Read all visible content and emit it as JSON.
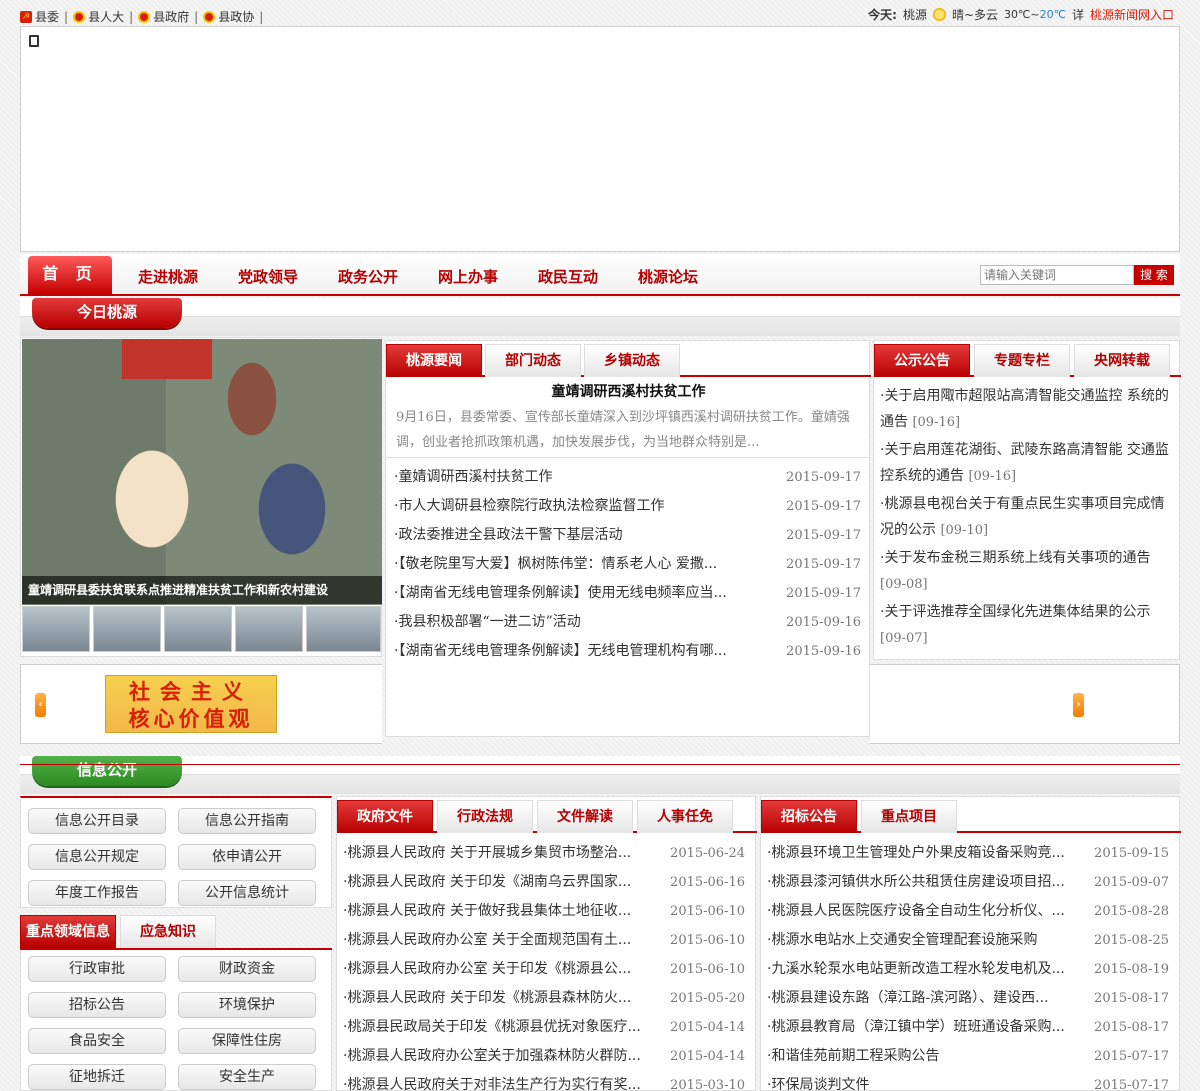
{
  "topbar": {
    "links": [
      "县委",
      "县人大",
      "县政府",
      "县政协"
    ],
    "weather_label": "今天:",
    "city": "桃源",
    "condition": "晴~多云",
    "temp_high": "30℃",
    "temp_sep": "~",
    "temp_low": "20℃",
    "detail": "详",
    "news_entry": "桃源新闻网入口"
  },
  "nav": {
    "home": "首 页",
    "items": [
      "走进桃源",
      "党政领导",
      "政务公开",
      "网上办事",
      "政民互动",
      "桃源论坛"
    ],
    "search_placeholder": "请输入关键词",
    "search_button": "搜 索"
  },
  "sections": {
    "today": "今日桃源",
    "info": "信息公开"
  },
  "photo": {
    "caption": "童靖调研县委扶贫联系点推进精准扶贫工作和新农村建设"
  },
  "news": {
    "tabs": [
      "桃源要闻",
      "部门动态",
      "乡镇动态"
    ],
    "headline": "童靖调研西溪村扶贫工作",
    "summary": "9月16日，县委常委、宣传部长童婧深入到沙坪镇西溪村调研扶贫工作。童婧强调，创业者抢抓政策机遇，加快发展步伐，为当地群众特别是...",
    "items": [
      {
        "title": "·童婧调研西溪村扶贫工作",
        "date": "2015-09-17"
      },
      {
        "title": "·市人大调研县检察院行政执法检察监督工作",
        "date": "2015-09-17"
      },
      {
        "title": "·政法委推进全县政法干警下基层活动",
        "date": "2015-09-17"
      },
      {
        "title": "·【敬老院里写大爱】枫树陈伟堂：情系老人心  爱撒...",
        "date": "2015-09-17"
      },
      {
        "title": "·【湖南省无线电管理条例解读】使用无线电频率应当...",
        "date": "2015-09-17"
      },
      {
        "title": "·我县积极部署“一进二访”活动",
        "date": "2015-09-16"
      },
      {
        "title": "·【湖南省无线电管理条例解读】无线电管理机构有哪...",
        "date": "2015-09-16"
      }
    ]
  },
  "notices": {
    "tabs": [
      "公示公告",
      "专题专栏",
      "央网转载"
    ],
    "items": [
      {
        "title": "·关于启用陬市超限站高清智能交通监控  系统的通告",
        "date": "[09-16]"
      },
      {
        "title": "·关于启用莲花湖街、武陵东路高清智能  交通监控系统的通告",
        "date": "[09-16]"
      },
      {
        "title": "·桃源县电视台关于有重点民生实事项目完成情况的公示",
        "date": "[09-10]"
      },
      {
        "title": "·关于发布金税三期系统上线有关事项的通告",
        "date": "[09-08]"
      },
      {
        "title": "·关于评选推荐全国绿化先进集体结果的公示",
        "date": "[09-07]"
      }
    ]
  },
  "values_banner": {
    "line1": "社会主义",
    "line2": "核心价值观"
  },
  "info_panel": {
    "grid1": [
      "信息公开目录",
      "信息公开指南",
      "信息公开规定",
      "依申请公开",
      "年度工作报告",
      "公开信息统计"
    ],
    "tabs": [
      "重点领域信息",
      "应急知识"
    ],
    "grid2": [
      "行政审批",
      "财政资金",
      "招标公告",
      "环境保护",
      "食品安全",
      "保障性住房",
      "征地拆迁",
      "安全生产"
    ]
  },
  "docs": {
    "tabs": [
      "政府文件",
      "行政法规",
      "文件解读",
      "人事任免"
    ],
    "items": [
      {
        "title": "·桃源县人民政府 关于开展城乡集贸市场整治...",
        "date": "2015-06-24"
      },
      {
        "title": "·桃源县人民政府 关于印发《湖南乌云界国家...",
        "date": "2015-06-16"
      },
      {
        "title": "·桃源县人民政府 关于做好我县集体土地征收...",
        "date": "2015-06-10"
      },
      {
        "title": "·桃源县人民政府办公室 关于全面规范国有土...",
        "date": "2015-06-10"
      },
      {
        "title": "·桃源县人民政府办公室 关于印发《桃源县公...",
        "date": "2015-06-10"
      },
      {
        "title": "·桃源县人民政府 关于印发《桃源县森林防火...",
        "date": "2015-05-20"
      },
      {
        "title": "·桃源县民政局关于印发《桃源县优抚对象医疗...",
        "date": "2015-04-14"
      },
      {
        "title": "·桃源县人民政府办公室关于加强森林防火群防...",
        "date": "2015-04-14"
      },
      {
        "title": "·桃源县人民政府关于对非法生产行为实行有奖...",
        "date": "2015-03-10"
      }
    ]
  },
  "tenders": {
    "tabs": [
      "招标公告",
      "重点项目"
    ],
    "items": [
      {
        "title": "·桃源县环境卫生管理处户外果皮箱设备采购竞...",
        "date": "2015-09-15"
      },
      {
        "title": "·桃源县漆河镇供水所公共租赁住房建设项目招...",
        "date": "2015-09-07"
      },
      {
        "title": "·桃源县人民医院医疗设备全自动生化分析仪、...",
        "date": "2015-08-28"
      },
      {
        "title": "·桃源水电站水上交通安全管理配套设施采购",
        "date": "2015-08-25"
      },
      {
        "title": "·九溪水轮泵水电站更新改造工程水轮发电机及...",
        "date": "2015-08-19"
      },
      {
        "title": "·桃源县建设东路（漳江路-滨河路）、建设西...",
        "date": "2015-08-17"
      },
      {
        "title": "·桃源县教育局（漳江镇中学）班班通设备采购...",
        "date": "2015-08-17"
      },
      {
        "title": "·和谐佳苑前期工程采购公告",
        "date": "2015-07-17"
      },
      {
        "title": "·环保局谈判文件",
        "date": "2015-07-17"
      }
    ]
  }
}
